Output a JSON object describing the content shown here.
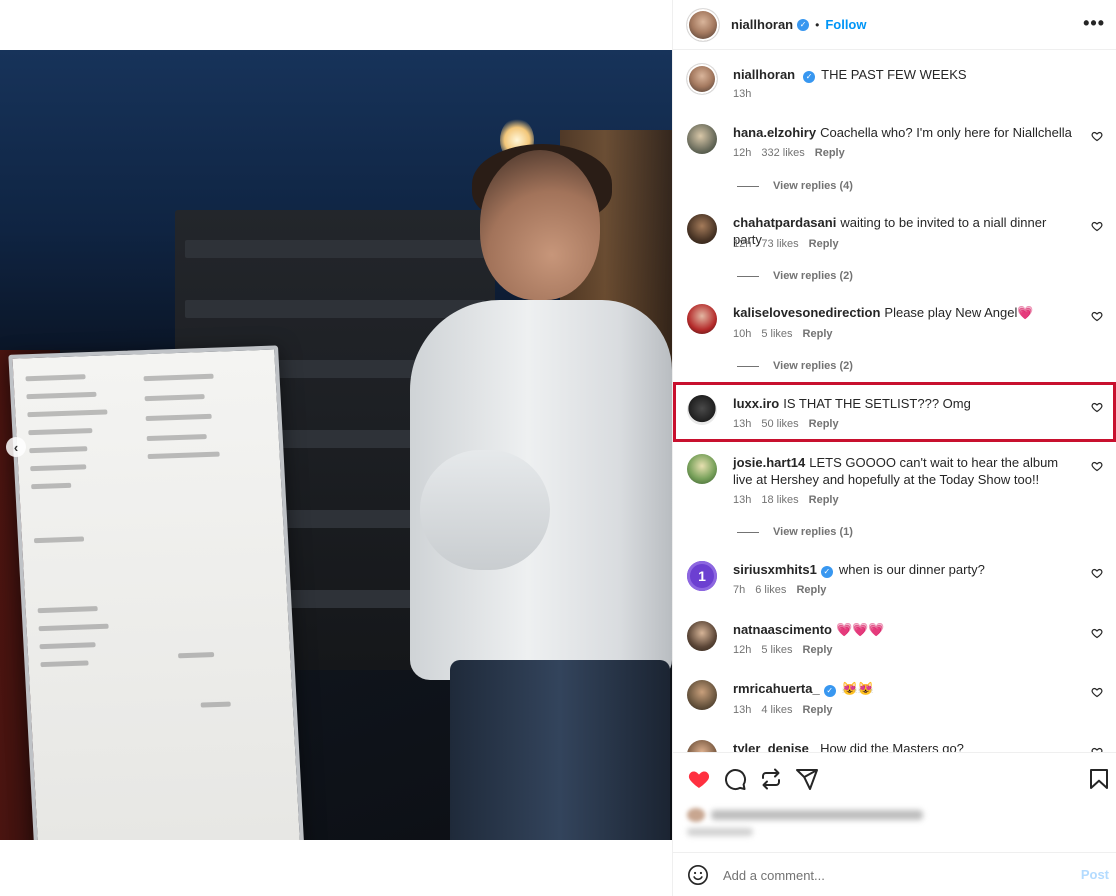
{
  "post": {
    "author": "niallhoran",
    "follow_label": "Follow",
    "dot": "•",
    "more_label": "•••",
    "caption": "THE PAST FEW WEEKS",
    "caption_time": "13h"
  },
  "comments": [
    {
      "user": "hana.elzohiry",
      "text": "Coachella who? I'm only here for Niallchella",
      "time": "12h",
      "likes": "332 likes",
      "reply": "Reply",
      "view_replies": "View replies (4)"
    },
    {
      "user": "chahatpardasani",
      "text": "waiting to be invited to a niall dinner party",
      "time": "12h",
      "likes": "73 likes",
      "reply": "Reply",
      "view_replies": "View replies (2)"
    },
    {
      "user": "kaliselovesonedirection",
      "text": "Please play New Angel💗",
      "time": "10h",
      "likes": "5 likes",
      "reply": "Reply",
      "view_replies": "View replies (2)"
    },
    {
      "user": "luxx.iro",
      "text": "IS THAT THE SETLIST??? Omg",
      "time": "13h",
      "likes": "50 likes",
      "reply": "Reply"
    },
    {
      "user": "josie.hart14",
      "text": "LETS GOOOO can't wait to hear the album live at Hershey and hopefully at the Today Show too!!",
      "time": "13h",
      "likes": "18 likes",
      "reply": "Reply",
      "view_replies": "View replies (1)"
    },
    {
      "user": "siriusxmhits1",
      "text": "when is our dinner party?",
      "time": "7h",
      "likes": "6 likes",
      "reply": "Reply",
      "avatar_text": "1"
    },
    {
      "user": "natnaascimento",
      "text": "💗💗💗",
      "time": "12h",
      "likes": "5 likes",
      "reply": "Reply"
    },
    {
      "user": "rmricahuerta_",
      "text": "😻😻",
      "time": "13h",
      "likes": "4 likes",
      "reply": "Reply"
    },
    {
      "user": "tyler_denise_",
      "text": "How did the Masters go?"
    }
  ],
  "composer": {
    "placeholder": "Add a comment...",
    "post_label": "Post"
  },
  "icons": {
    "like": "heart-filled-icon",
    "comment": "comment-icon",
    "share": "repost-icon",
    "send": "send-icon",
    "save": "bookmark-icon",
    "emoji": "smile-icon",
    "prev": "chevron-left-icon"
  },
  "colors": {
    "accent": "#0095f6",
    "like_red": "#ff3040",
    "highlight": "#c8102e",
    "verified": "#3897f0",
    "post_disabled": "#b3dbff"
  }
}
